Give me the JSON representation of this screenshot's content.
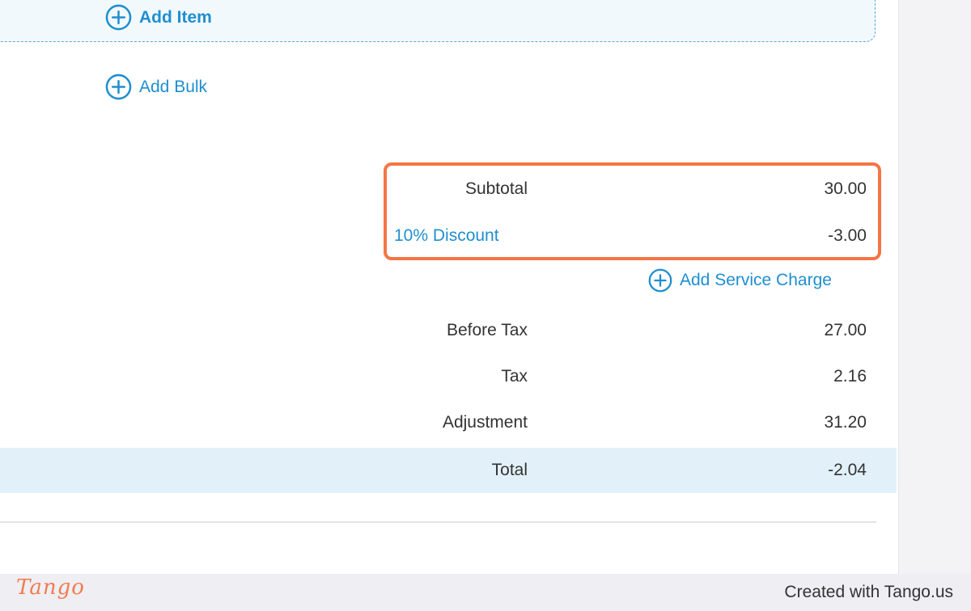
{
  "actions": {
    "add_item": "Add Item",
    "add_bulk": "Add Bulk",
    "add_service_charge": "Add Service Charge"
  },
  "summary": {
    "subtotal": {
      "label": "Subtotal",
      "value": "30.00"
    },
    "discount": {
      "label": "10% Discount",
      "value": "-3.00"
    },
    "before_tax": {
      "label": "Before Tax",
      "value": "27.00"
    },
    "tax": {
      "label": "Tax",
      "value": "2.16"
    },
    "adjustment": {
      "label": "Adjustment",
      "value": "31.20"
    },
    "total": {
      "label": "Total",
      "value": "-2.04"
    }
  },
  "footer": {
    "logo": "Tango",
    "created_with": "Created with Tango.us"
  },
  "colors": {
    "link": "#1f8fcf",
    "highlight": "#f57545",
    "total_row_bg": "#e2f1f9"
  }
}
